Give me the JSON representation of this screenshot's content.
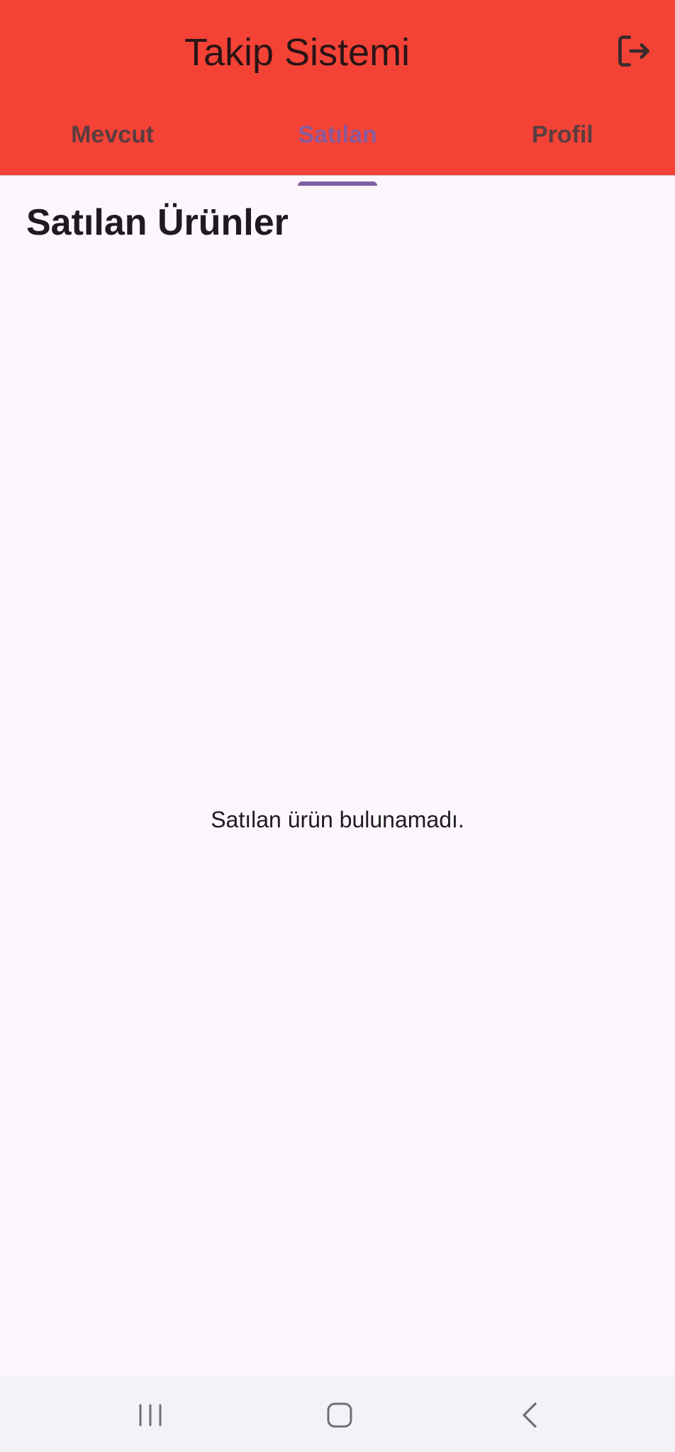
{
  "appbar": {
    "title": "Takip Sistemi",
    "logout_icon": "logout-icon",
    "background": "#f44336"
  },
  "tabs": [
    {
      "label": "Mevcut",
      "active": false
    },
    {
      "label": "Satılan",
      "active": true
    },
    {
      "label": "Profil",
      "active": false
    }
  ],
  "content": {
    "heading": "Satılan Ürünler",
    "empty_message": "Satılan ürün bulunamadı."
  },
  "system_nav": {
    "recents_icon": "recents-icon",
    "home_icon": "home-icon",
    "back_icon": "back-icon"
  },
  "colors": {
    "accent": "#7e5ea0",
    "background": "#fdf7fd"
  }
}
